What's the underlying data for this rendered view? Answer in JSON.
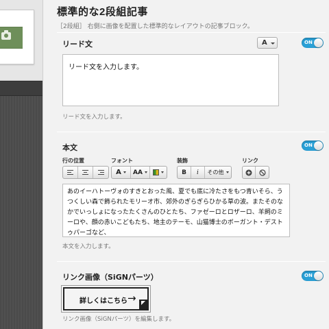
{
  "panel": {
    "title": "標準的な2段組記事",
    "description": "［2段組］ 右側に画像を配置した標準的なレイアウトの記事ブロック。"
  },
  "lead": {
    "label": "リード文",
    "font_button": "A",
    "toggle": "ON",
    "value": "リード文を入力します。",
    "help": "リード文を入力します。"
  },
  "body": {
    "label": "本文",
    "toggle": "ON",
    "groups": {
      "position": "行の位置",
      "font": "フォント",
      "decoration": "装飾",
      "link": "リンク"
    },
    "font_size_button": "A",
    "font_scale_button": "AA",
    "bold": "B",
    "italic": "i",
    "other": "その他",
    "value": "あのイーハトーヴォのすきとおった風、夏でも底に冷たさをもつ青いそら、うつくしい森で飾られたモリーオ市、郊外のぎらぎらひかる草の波。またそのなかでいっしょになったたくさんのひとたち、ファゼーロとロザーロ、羊飼のミーロや、顔の赤いこどもたち、地主のテーモ、山猫博士のボーガント・デストゥパーゴなど、",
    "help": "本文を入力します。"
  },
  "link_image": {
    "label": "リンク画像（SiGNパーツ）",
    "toggle": "ON",
    "button_text": "詳しくはこちら",
    "button_arrow": "→",
    "help": "リンク画像（SiGNパーツ）を編集します。"
  },
  "colors": {
    "toggle_on": "#2aa0d6",
    "photo_placeholder": "#6e8f5a"
  }
}
